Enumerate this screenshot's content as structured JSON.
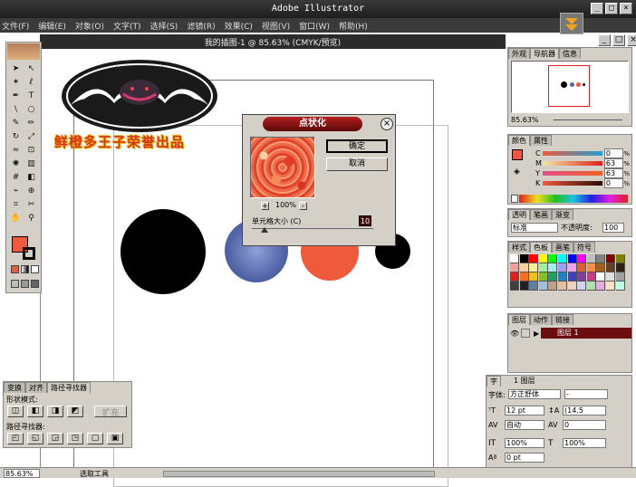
{
  "app": {
    "title": "Adobe Illustrator"
  },
  "menu": [
    "文件(F)",
    "编辑(E)",
    "对象(O)",
    "文字(T)",
    "选择(S)",
    "滤镜(R)",
    "效果(C)",
    "视图(V)",
    "窗口(W)",
    "帮助(H)"
  ],
  "document": {
    "title": "我的插图-1 @ 85.63% (CMYK/预览)"
  },
  "watermark": {
    "text": "鲜橙多王子荣誉出品"
  },
  "dialog": {
    "title": "点状化",
    "ok": "确定",
    "cancel": "取消",
    "zoom": "100%",
    "zoom_in": "+",
    "zoom_out": "-",
    "cell_label": "单元格大小 (C)",
    "cell_value": "10"
  },
  "navigator": {
    "tabs": [
      "外观",
      "导航器",
      "信息"
    ],
    "zoom": "85.63%"
  },
  "color": {
    "tabs": [
      "颜色",
      "属性"
    ],
    "labels": [
      "C",
      "M",
      "Y",
      "K"
    ],
    "values": [
      "0",
      "63",
      "63",
      "0"
    ],
    "unit": "%"
  },
  "transparency": {
    "tabs": [
      "透明",
      "笔画",
      "渐变"
    ],
    "mode": "标准",
    "opacity_label": "不透明度:",
    "opacity": "100"
  },
  "swatches": {
    "tabs": [
      "样式",
      "色板",
      "画笔",
      "符号"
    ]
  },
  "layers": {
    "tabs": [
      "图层",
      "动作",
      "链接"
    ],
    "layer_name": "图层  1",
    "footer": "1 图层"
  },
  "character": {
    "tab": "字",
    "font_label": "字体:",
    "font": "方正舒体",
    "style": "-",
    "size": "12 pt",
    "leading": "(14.5",
    "tracking_mode": "自动",
    "tracking": "0",
    "scale_h": "100%",
    "scale_v": "100%",
    "baseline": "0 pt"
  },
  "pathfinder": {
    "tabs": [
      "变换",
      "对齐",
      "路径寻找器"
    ],
    "shape_label": "形状模式:",
    "path_label": "路径寻找器:",
    "expand": "扩充"
  },
  "status": {
    "zoom": "85.63%",
    "tool": "选取工具"
  },
  "colors": {
    "fill": "#f05a3c",
    "dark": "#2b2b2b"
  }
}
